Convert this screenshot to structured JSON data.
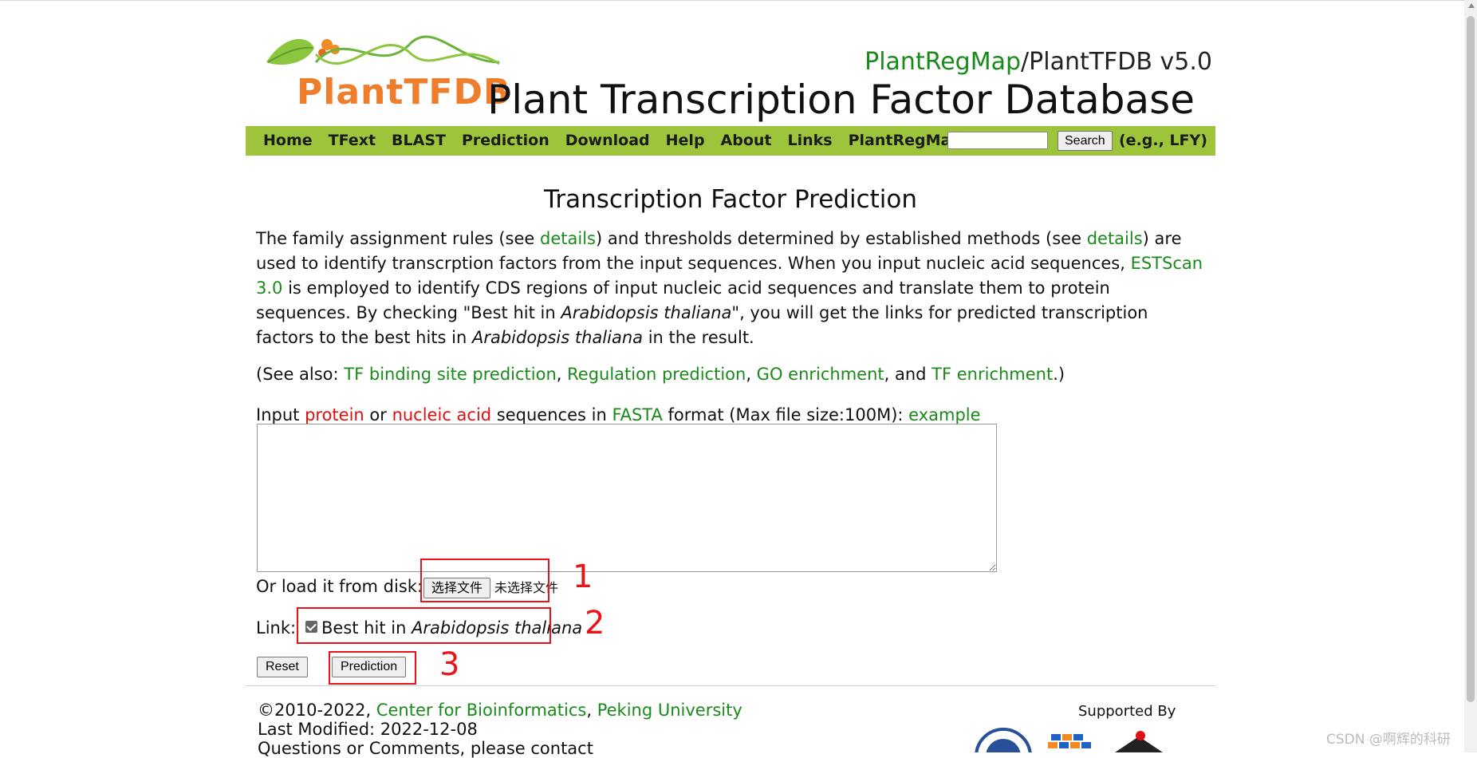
{
  "header": {
    "logo_text": "PlantTFDB",
    "brand_link": "PlantRegMap",
    "brand_rest": "/PlantTFDB v5.0",
    "site_title": "Plant Transcription Factor Database"
  },
  "nav": {
    "items": [
      "Home",
      "TFext",
      "BLAST",
      "Prediction",
      "Download",
      "Help",
      "About",
      "Links",
      "PlantRegMap"
    ],
    "search_button": "Search",
    "search_example": "(e.g., LFY)",
    "search_value": ""
  },
  "content": {
    "title": "Transcription Factor Prediction",
    "para": {
      "t1": "The family assignment rules (see ",
      "l1": "details",
      "t2": ") and thresholds determined by established methods (see ",
      "l2": "details",
      "t3": ") are used to identify transcrption factors from the input sequences. When you input nucleic acid sequences, ",
      "l3": "ESTScan 3.0",
      "t4": " is employed to identify CDS regions of input nucleic acid sequences and translate them to protein sequences. By checking \"Best hit in ",
      "i1": "Arabidopsis thaliana",
      "t5": "\", you will get the links for predicted transcription factors to the best hits in ",
      "i2": "Arabidopsis thaliana",
      "t6": " in the result."
    },
    "see_also": {
      "prefix": "(See also: ",
      "l1": "TF binding site prediction",
      "sep1": ", ",
      "l2": "Regulation prediction",
      "sep2": ", ",
      "l3": "GO enrichment",
      "sep3": ", and ",
      "l4": "TF enrichment",
      "suffix": ".)"
    },
    "input_label": {
      "t1": "Input ",
      "r1": "protein",
      "t2": " or ",
      "r2": "nucleic acid",
      "t3": " sequences in ",
      "l1": "FASTA",
      "t4": " format (Max file size:100M): ",
      "l2": "example"
    },
    "sequence_value": "",
    "disk_label": "Or load it from disk:",
    "file_button": "选择文件",
    "file_status": "未选择文件",
    "link_label": "Link:",
    "checkbox_checked": true,
    "checkbox_text": "Best hit in ",
    "checkbox_italic": "Arabidopsis thaliana",
    "reset_button": "Reset",
    "predict_button": "Prediction"
  },
  "footer": {
    "copyright": "©2010-2022, ",
    "center_link": "Center for Bioinformatics",
    "sep": ", ",
    "univ_link": "Peking University",
    "last_modified": "Last Modified: 2022-12-08",
    "questions": "Questions or Comments, please contact",
    "supported_by": "Supported By"
  },
  "annotations": [
    "1",
    "2",
    "3"
  ],
  "watermark": "CSDN @啊辉的科研",
  "colors": {
    "nav_bg": "#9dc43b",
    "link": "#1a8a1a",
    "accent_red": "#e01010",
    "logo_orange": "#ee7d2c",
    "annotation_red": "#e8141a"
  }
}
